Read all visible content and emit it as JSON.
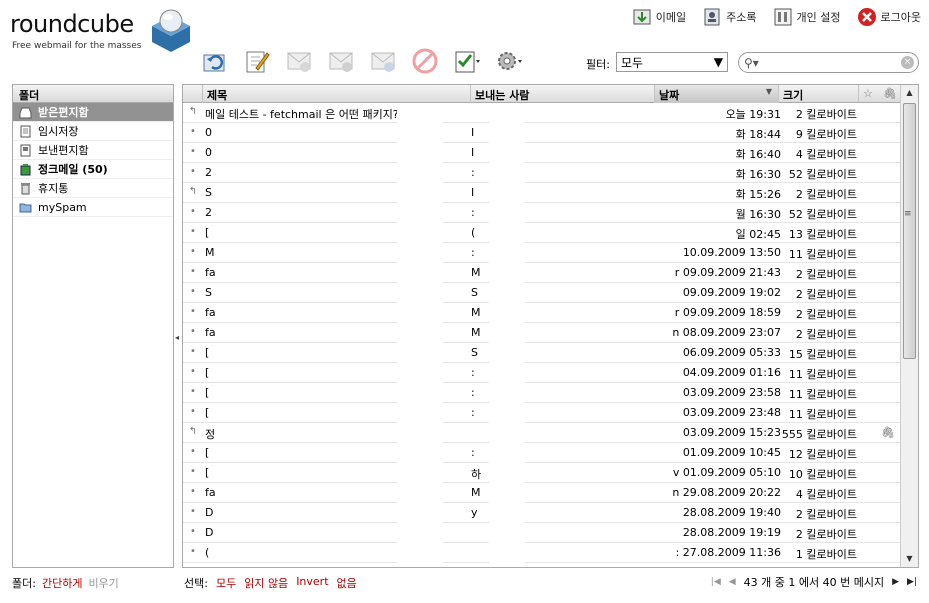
{
  "logo": {
    "name": "roundcube",
    "tagline": "Free webmail for the masses"
  },
  "topnav": [
    {
      "label": "이메일",
      "icon": "mail-icon"
    },
    {
      "label": "주소록",
      "icon": "address-book-icon"
    },
    {
      "label": "개인 설정",
      "icon": "settings-icon"
    },
    {
      "label": "로그아웃",
      "icon": "logout-icon"
    }
  ],
  "toolbar": [
    {
      "icon": "refresh-icon",
      "enabled": true
    },
    {
      "icon": "compose-icon",
      "enabled": true
    },
    {
      "icon": "reply-icon",
      "enabled": false
    },
    {
      "icon": "reply-all-icon",
      "enabled": false
    },
    {
      "icon": "forward-icon",
      "enabled": false
    },
    {
      "icon": "delete-icon",
      "enabled": false
    },
    {
      "icon": "mark-icon",
      "enabled": true
    },
    {
      "icon": "more-gear-icon",
      "enabled": true
    }
  ],
  "filter": {
    "label": "필터:",
    "value": "모두"
  },
  "search": {
    "placeholder": ""
  },
  "folders": {
    "header": "폴더",
    "items": [
      {
        "label": "받은편지함",
        "icon": "inbox-icon",
        "selected": true
      },
      {
        "label": "임시저장",
        "icon": "drafts-icon"
      },
      {
        "label": "보낸편지함",
        "icon": "sent-icon"
      },
      {
        "label": "정크메일 (50)",
        "icon": "junk-icon",
        "bold": true
      },
      {
        "label": "휴지통",
        "icon": "trash-icon"
      },
      {
        "label": "mySpam",
        "icon": "folder-icon"
      }
    ]
  },
  "list": {
    "columns": {
      "subject": "제목",
      "from": "보내는 사람",
      "date": "날짜",
      "size": "크기"
    },
    "rows": [
      {
        "status": "replied",
        "subject": "메일 테스트 - fetchmail 은 어떤 패키지?",
        "from": "",
        "date": "오늘 19:31",
        "size": "2 킬로바이트",
        "att": false
      },
      {
        "status": "read",
        "subject": "0",
        "from": "I",
        "date": "화 18:44",
        "size": "9 킬로바이트",
        "att": false
      },
      {
        "status": "read",
        "subject": "0",
        "from": "I",
        "date": "화 16:40",
        "size": "4 킬로바이트",
        "att": false
      },
      {
        "status": "read",
        "subject": "2",
        "from": ":",
        "date": "화 16:30",
        "size": "52 킬로바이트",
        "att": false
      },
      {
        "status": "replied",
        "subject": "S",
        "from": "I",
        "date": "화 15:26",
        "size": "2 킬로바이트",
        "att": false
      },
      {
        "status": "read",
        "subject": "2",
        "from": ":",
        "date": "월 16:30",
        "size": "52 킬로바이트",
        "att": false
      },
      {
        "status": "read",
        "subject": "[",
        "from": "(",
        "date": "일 02:45",
        "size": "13 킬로바이트",
        "att": false
      },
      {
        "status": "read",
        "subject": "M",
        "from": ":",
        "date": "10.09.2009 13:50",
        "size": "11 킬로바이트",
        "att": false
      },
      {
        "status": "read",
        "subject": "fa",
        "from": "M",
        "date": "r 09.09.2009 21:43",
        "size": "2 킬로바이트",
        "att": false
      },
      {
        "status": "read",
        "subject": "S",
        "from": "S",
        "date": "09.09.2009 19:02",
        "size": "2 킬로바이트",
        "att": false
      },
      {
        "status": "read",
        "subject": "fa",
        "from": "M",
        "date": "r 09.09.2009 18:59",
        "size": "2 킬로바이트",
        "att": false
      },
      {
        "status": "read",
        "subject": "fa",
        "from": "M",
        "date": "n 08.09.2009 23:07",
        "size": "2 킬로바이트",
        "att": false
      },
      {
        "status": "read",
        "subject": "[",
        "from": "S",
        "date": "06.09.2009 05:33",
        "size": "15 킬로바이트",
        "att": false
      },
      {
        "status": "read",
        "subject": "[",
        "from": ":",
        "date": "04.09.2009 01:16",
        "size": "11 킬로바이트",
        "att": false
      },
      {
        "status": "read",
        "subject": "[",
        "from": ":",
        "date": "03.09.2009 23:58",
        "size": "11 킬로바이트",
        "att": false
      },
      {
        "status": "read",
        "subject": "[",
        "from": ":",
        "date": "03.09.2009 23:48",
        "size": "11 킬로바이트",
        "att": false
      },
      {
        "status": "replied",
        "subject": "정",
        "from": "",
        "date": "03.09.2009 15:23",
        "size": "555 킬로바이트",
        "att": true
      },
      {
        "status": "read",
        "subject": "[",
        "from": ":",
        "date": "01.09.2009 10:45",
        "size": "12 킬로바이트",
        "att": false
      },
      {
        "status": "read",
        "subject": "[",
        "from": "하",
        "date": "v 01.09.2009 05:10",
        "size": "10 킬로바이트",
        "att": false
      },
      {
        "status": "read",
        "subject": "fa",
        "from": "M",
        "date": "n 29.08.2009 20:22",
        "size": "4 킬로바이트",
        "att": false
      },
      {
        "status": "read",
        "subject": "D",
        "from": "y",
        "date": "28.08.2009 19:40",
        "size": "2 킬로바이트",
        "att": false
      },
      {
        "status": "read",
        "subject": "D",
        "from": "",
        "date": "28.08.2009 19:19",
        "size": "2 킬로바이트",
        "att": false
      },
      {
        "status": "read",
        "subject": "(",
        "from": "",
        "date": ": 27.08.2009 11:36",
        "size": "1 킬로바이트",
        "att": false
      }
    ]
  },
  "footer": {
    "folders_label": "폴더:",
    "compact": "간단하게",
    "empty": "비우기",
    "select_label": "선택:",
    "select_all": "모두",
    "select_unread": "읽지 않음",
    "select_invert": "Invert",
    "select_none": "없음",
    "pager_text": "43 개 중 1 에서 40 번 메시지"
  }
}
